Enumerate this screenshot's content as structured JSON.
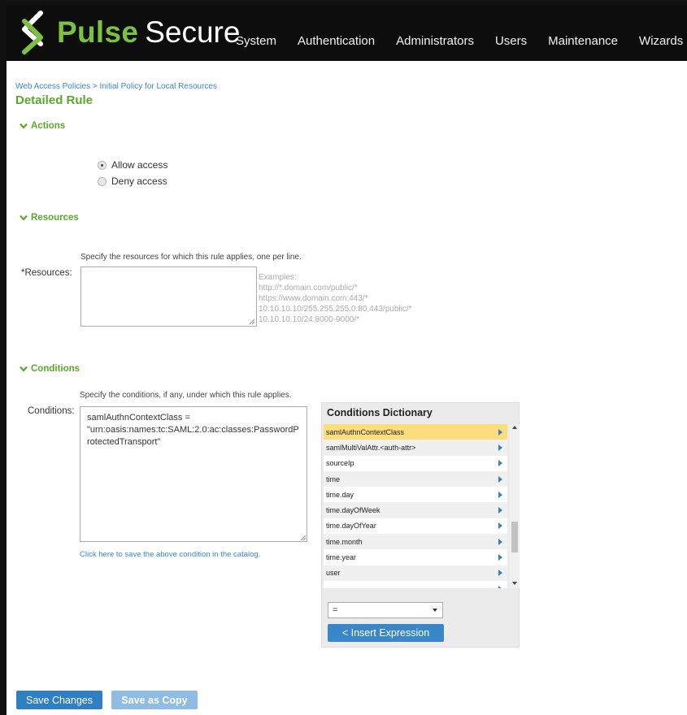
{
  "brand": {
    "name_part1": "Pulse",
    "name_part2": "Secure",
    "pulse_color": "#7cc142"
  },
  "nav": [
    "System",
    "Authentication",
    "Administrators",
    "Users",
    "Maintenance",
    "Wizards"
  ],
  "breadcrumb": "Web Access Policies > Initial Policy for Local Resources",
  "page_title": "Detailed Rule",
  "actions": {
    "heading": "Actions",
    "options": [
      {
        "label": "Allow access",
        "selected": true
      },
      {
        "label": "Deny access",
        "selected": false
      }
    ]
  },
  "resources": {
    "heading": "Resources",
    "hint": "Specify the resources for which this rule applies, one per line.",
    "label": "*Resources:",
    "value": "",
    "examples_title": "Examples:",
    "examples": [
      "http://*.domain.com/public/*",
      "https://www.domain.com:443/*",
      "10.10.10.10/255.255.255.0:80,443/public/*",
      "10.10.10.10/24:8000-9000/*"
    ]
  },
  "conditions": {
    "heading": "Conditions",
    "hint": "Specify the conditions, if any, under which this rule applies.",
    "label": "Conditions:",
    "value": "samlAuthnContextClass =\n\"urn:oasis:names:tc:SAML:2.0:ac:classes:PasswordProtectedTransport\"",
    "save_link": "Click here to save the above condition in the catalog."
  },
  "dictionary": {
    "title": "Conditions Dictionary",
    "items": [
      {
        "label": "samlAuthnContextClass",
        "selected": true
      },
      {
        "label": "samlMultiValAttr.<auth-attr>",
        "selected": false
      },
      {
        "label": "sourceIp",
        "selected": false
      },
      {
        "label": "time",
        "selected": false
      },
      {
        "label": "time.day",
        "selected": false
      },
      {
        "label": "time.dayOfWeek",
        "selected": false
      },
      {
        "label": "time.dayOfYear",
        "selected": false
      },
      {
        "label": "time.month",
        "selected": false
      },
      {
        "label": "time.year",
        "selected": false
      },
      {
        "label": "user",
        "selected": false
      },
      {
        "label": "",
        "selected": false
      }
    ],
    "operator": "=",
    "insert_label": "< Insert Expression"
  },
  "buttons": {
    "save": "Save Changes",
    "copy": "Save as Copy"
  }
}
